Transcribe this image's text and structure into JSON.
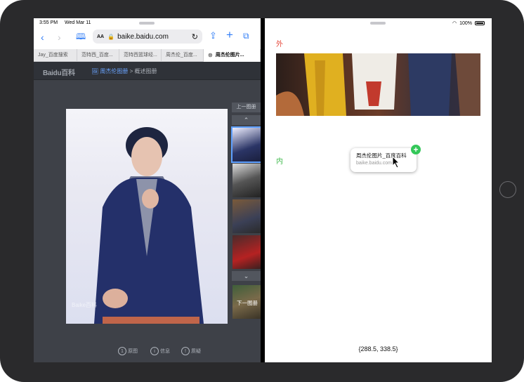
{
  "status_left": {
    "time": "3:55 PM",
    "date": "Wed Mar 11"
  },
  "status_right": {
    "battery": "100%"
  },
  "browser": {
    "url": "baike.baidu.com",
    "text_size_label": "AA",
    "tabs": [
      "Jay_百度搜索",
      "范特西_百度...",
      "范特西篮球经...",
      "周杰伦_百度...",
      "周杰伦图片..."
    ]
  },
  "baike": {
    "logo": "Baidu百科",
    "breadcrumb_link": "周杰伦图册",
    "breadcrumb_sep": ">",
    "breadcrumb_current": "概述图册",
    "prev_album": "上一图册",
    "next_album": "下一图册",
    "watermark": "Baike百科",
    "bottom": {
      "original": "原图",
      "info": "信息",
      "report": "质疑"
    }
  },
  "right": {
    "outer_label": "外",
    "inner_label": "内",
    "drag_title": "周杰伦图片_百度百科",
    "drag_url": "baike.baidu.com",
    "plus": "+",
    "coordinates": "{288.5, 338.5}"
  }
}
